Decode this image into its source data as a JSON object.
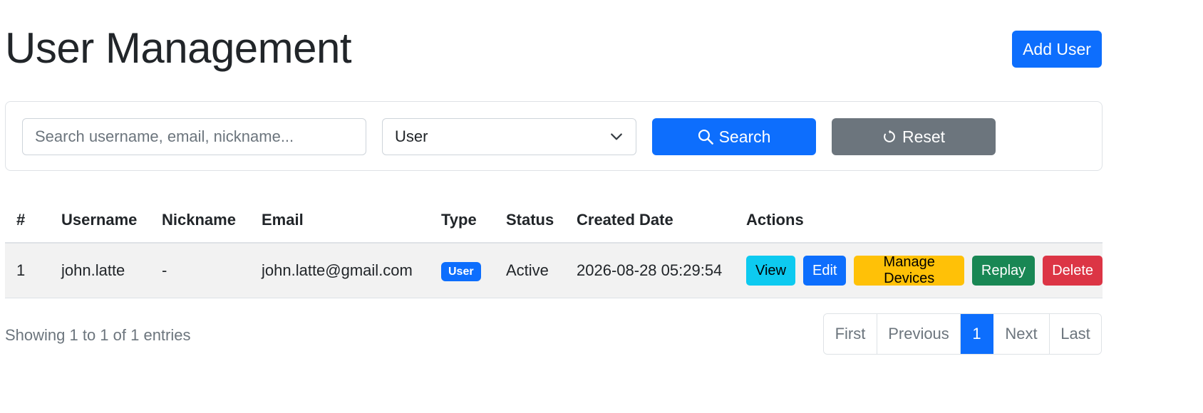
{
  "header": {
    "title": "User Management",
    "add_user_label": "Add User"
  },
  "filters": {
    "search_placeholder": "Search username, email, nickname...",
    "search_value": "",
    "type_selected": "User",
    "search_label": "Search",
    "reset_label": "Reset"
  },
  "table": {
    "columns": [
      "#",
      "Username",
      "Nickname",
      "Email",
      "Type",
      "Status",
      "Created Date",
      "Actions"
    ],
    "rows": [
      {
        "num": "1",
        "username": "john.latte",
        "nickname": "-",
        "email": "john.latte@gmail.com",
        "type": "User",
        "status": "Active",
        "created": "2026-08-28 05:29:54",
        "actions": {
          "view": "View",
          "edit": "Edit",
          "manage_devices": "Manage Devices",
          "replay": "Replay",
          "delete": "Delete"
        }
      }
    ]
  },
  "footer": {
    "info": "Showing 1 to 1 of 1 entries",
    "pagination": {
      "first": "First",
      "previous": "Previous",
      "current": "1",
      "next": "Next",
      "last": "Last"
    }
  },
  "colors": {
    "primary": "#0d6efd",
    "secondary": "#6c757d",
    "info": "#0dcaf0",
    "warning": "#ffc107",
    "success": "#198754",
    "danger": "#dc3545"
  },
  "icons": {
    "search": "search-icon",
    "reset": "reset-icon",
    "select": "chevron-down-icon"
  }
}
